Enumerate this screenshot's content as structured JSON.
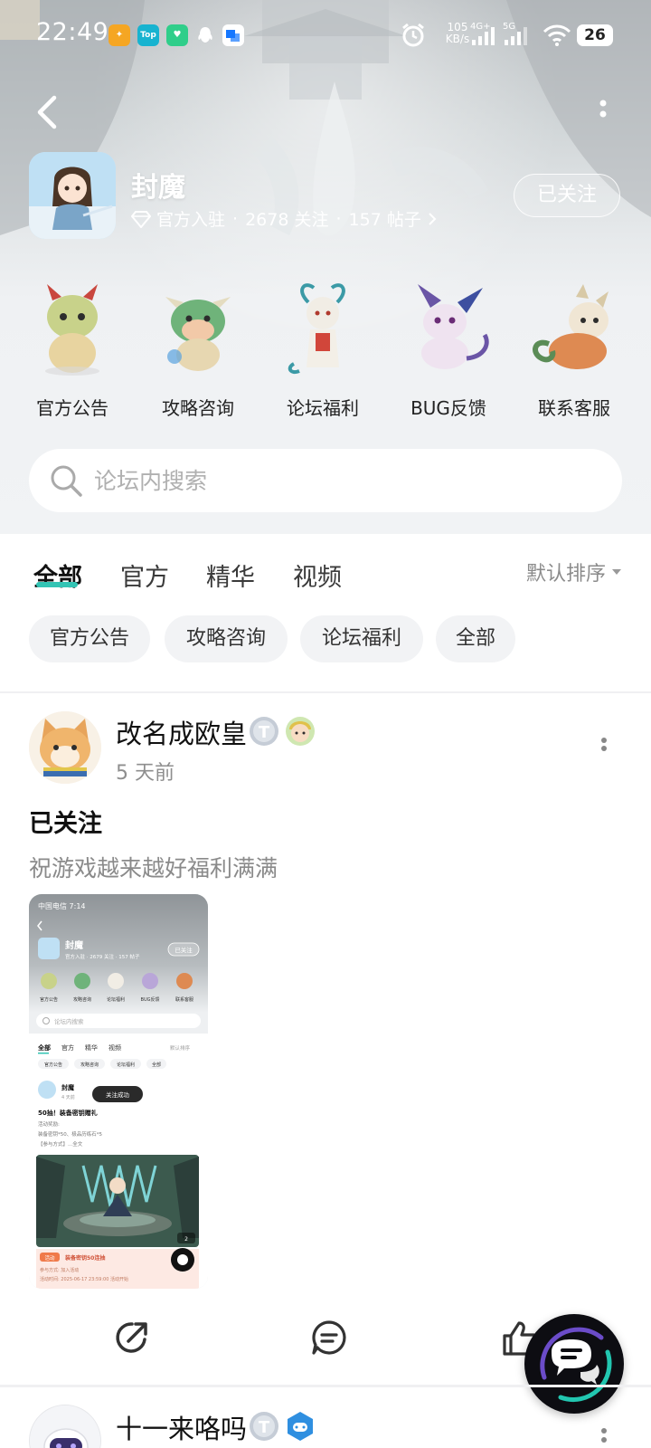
{
  "status_bar": {
    "time": "22:49",
    "speed_value": "105",
    "speed_unit": "KB/s",
    "net1": "4G+",
    "net2": "5G",
    "battery": "26",
    "app_icons": [
      "map-app-icon",
      "top-app-icon",
      "chat-app-icon",
      "qq-icon",
      "alipay-icon"
    ]
  },
  "forum": {
    "name": "封魔",
    "verified": "官方入驻",
    "follows": "2678 关注",
    "posts": "157 帖子",
    "follow_state": "已关注"
  },
  "categories": [
    {
      "label": "官方公告"
    },
    {
      "label": "攻略咨询"
    },
    {
      "label": "论坛福利"
    },
    {
      "label": "BUG反馈"
    },
    {
      "label": "联系客服"
    }
  ],
  "search": {
    "placeholder": "论坛内搜索"
  },
  "tabs": [
    {
      "label": "全部",
      "active": true
    },
    {
      "label": "官方"
    },
    {
      "label": "精华"
    },
    {
      "label": "视频"
    }
  ],
  "sort": {
    "label": "默认排序"
  },
  "chips": [
    "官方公告",
    "攻略咨询",
    "论坛福利",
    "全部"
  ],
  "post": {
    "user": "改名成欧皇",
    "time": "5 天前",
    "title": "已关注",
    "body": "祝游戏越来越好福利满满"
  },
  "post_image": {
    "time": "中国电信 7:14",
    "forum_name": "封魔",
    "meta": "官方入驻 · 2679 关注 · 157 帖子",
    "follow": "已关注",
    "cats": [
      "官方公告",
      "攻略咨询",
      "论坛福利",
      "BUG反馈",
      "联系客服"
    ],
    "search": "论坛内搜索",
    "tabs": [
      "全部",
      "官方",
      "精华",
      "视频"
    ],
    "sort": "默认排序",
    "chips": [
      "官方公告",
      "攻略咨询",
      "论坛福利",
      "全部"
    ],
    "user": "封魔",
    "user_time": "4 天前",
    "toast": "关注成功",
    "title": "50抽！装备密钥赠礼",
    "line1": "活动奖励:",
    "line2": "装备密钥*50、极品历练石*5",
    "line3": "【参与方式】...全文",
    "img_count": "2",
    "banner_tag": "活动",
    "banner_title": "装备密钥50连抽",
    "banner_line1": "参与方式: 加入活动",
    "banner_line2": "活动时间: 2025-06-17 23:59:00 活动开始"
  },
  "next_post": {
    "user": "十一来咯吗"
  }
}
